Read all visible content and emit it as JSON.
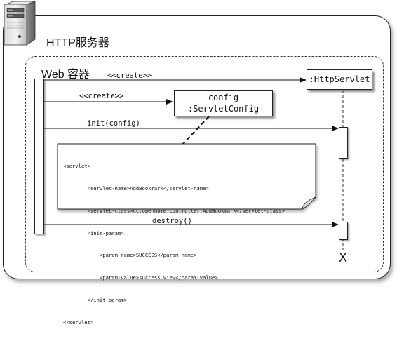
{
  "server": {
    "title": "HTTP服务器",
    "icon": "server-icon"
  },
  "container": {
    "title": "Web 容器"
  },
  "participants": {
    "httpservlet": ":HttpServlet",
    "config_line1": "config",
    "config_line2": ":ServletConfig"
  },
  "messages": {
    "create_servlet": "<<create>>",
    "create_config": "<<create>>",
    "init": "init(config)",
    "destroy": "destroy()"
  },
  "note": {
    "lines": [
      "<servlet>",
      "        <servlet-name>AddBookmark</servlet-name>",
      "        <servlet-class>cc.openhome.controller.AddBookmark</servlet-class>",
      "        <init-param>",
      "            <param-name>SUCCESS</param-name>",
      "            <param-value>success.view</param-value>",
      "        </init-param>",
      "</servlet>"
    ]
  },
  "lifeline_end": "X"
}
